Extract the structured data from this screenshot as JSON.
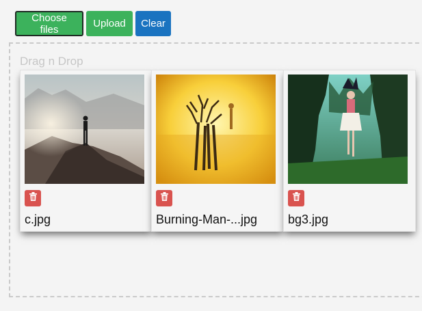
{
  "toolbar": {
    "choose_label": "Choose files",
    "upload_label": "Upload",
    "clear_label": "Clear"
  },
  "dropzone": {
    "label": "Drag n Drop"
  },
  "files": [
    {
      "name": "c.jpg",
      "icon": "trash-icon"
    },
    {
      "name": "Burning-Man-...jpg",
      "icon": "trash-icon"
    },
    {
      "name": "bg3.jpg",
      "icon": "trash-icon"
    }
  ],
  "colors": {
    "success": "#3cb25c",
    "primary": "#1a73c0",
    "danger": "#d9534f"
  }
}
